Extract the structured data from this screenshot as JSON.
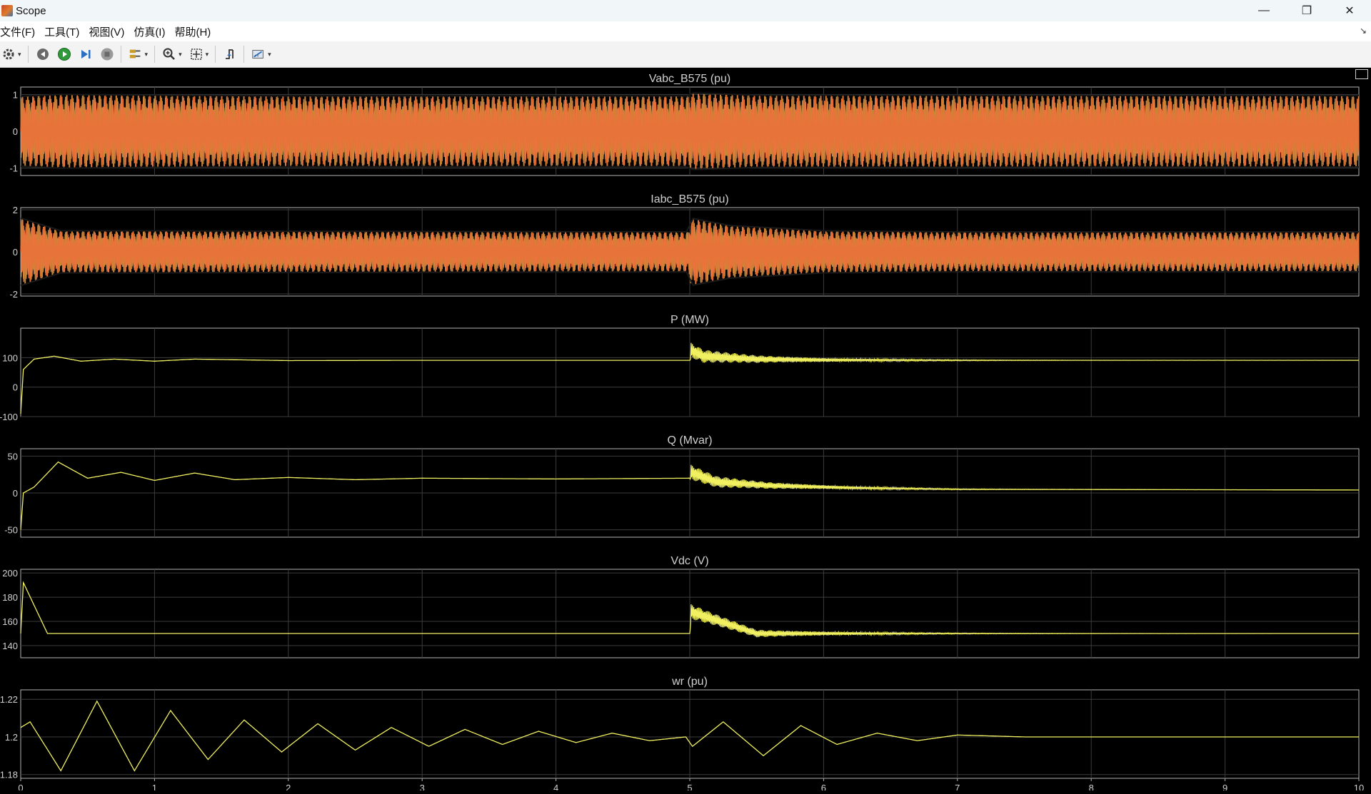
{
  "window": {
    "title": "Scope",
    "controls": {
      "minimize": "—",
      "restore": "❐",
      "close": "✕"
    }
  },
  "menu": [
    "文件(F)",
    "工具(T)",
    "视图(V)",
    "仿真(I)",
    "帮助(H)"
  ],
  "toolbar": [
    {
      "name": "settings-icon",
      "icon": "gear-icon",
      "dropdown": true
    },
    {
      "name": "step-back-icon",
      "icon": "step-back-icon",
      "dropdown": false
    },
    {
      "name": "run-icon",
      "icon": "play-icon",
      "dropdown": false
    },
    {
      "name": "step-forward-icon",
      "icon": "step-forward-icon",
      "dropdown": false
    },
    {
      "name": "stop-icon",
      "icon": "stop-icon",
      "dropdown": false
    },
    {
      "name": "highlight-icon",
      "icon": "signal-highlight-icon",
      "dropdown": true
    },
    {
      "name": "zoom-icon",
      "icon": "zoom-in-icon",
      "dropdown": true
    },
    {
      "name": "autoscale-icon",
      "icon": "fit-to-view-icon",
      "dropdown": true
    },
    {
      "name": "triggers-icon",
      "icon": "trigger-icon",
      "dropdown": false
    },
    {
      "name": "measure-icon",
      "icon": "cursor-measurement-icon",
      "dropdown": true
    }
  ],
  "colors": {
    "background": "#000000",
    "grid": "#3c3c3c",
    "axes": "#b4b4b4",
    "text": "#d0d0d0",
    "yellow": "#f0f060",
    "orange": "#e8733a",
    "blue": "#4a90d9"
  },
  "chart_data": [
    {
      "type": "line",
      "title": "Vabc_B575 (pu)",
      "kind": "ac",
      "ylim": [
        -1.2,
        1.2
      ],
      "yticks": [
        1,
        0,
        -1
      ],
      "ytick_labels": [
        "1",
        "0",
        "-1"
      ],
      "xlim": [
        0,
        10
      ],
      "series": [
        {
          "name": "",
          "color": "#e8733a",
          "x": [
            0,
            0.3,
            1,
            2,
            4.99,
            5.01,
            5.5,
            10
          ],
          "envelope": [
            0.95,
            1.0,
            0.98,
            0.96,
            0.96,
            1.04,
            0.98,
            0.97
          ]
        }
      ]
    },
    {
      "type": "line",
      "title": "Iabc_B575 (pu)",
      "kind": "ac",
      "ylim": [
        -2.1,
        2.1
      ],
      "yticks": [
        2,
        0,
        -2
      ],
      "ytick_labels": [
        "2",
        "0",
        "-2"
      ],
      "xlim": [
        0,
        10
      ],
      "series": [
        {
          "name": "",
          "color": "#e8733a",
          "x": [
            0,
            0.05,
            0.3,
            1,
            2,
            4.99,
            5.01,
            5.3,
            6,
            7,
            10
          ],
          "envelope": [
            1.6,
            1.5,
            1.0,
            1.0,
            0.98,
            0.95,
            1.6,
            1.25,
            1.0,
            0.95,
            0.95
          ]
        }
      ]
    },
    {
      "type": "line",
      "title": "P (MW)",
      "kind": "signal",
      "ylim": [
        -100,
        200
      ],
      "yticks": [
        100,
        0,
        -100
      ],
      "ytick_labels": [
        "100",
        "0",
        "-100"
      ],
      "xlim": [
        0,
        10
      ],
      "series": [
        {
          "name": "",
          "color": "#f0f060",
          "x": [
            0,
            0.02,
            0.1,
            0.25,
            0.45,
            0.7,
            1.0,
            1.3,
            2,
            3,
            5,
            5.01,
            5.1,
            5.5,
            6,
            7,
            10
          ],
          "y": [
            -90,
            60,
            95,
            105,
            88,
            95,
            88,
            95,
            90,
            91,
            91,
            125,
            105,
            95,
            92,
            91,
            91
          ]
        }
      ]
    },
    {
      "type": "line",
      "title": "Q (Mvar)",
      "kind": "signal",
      "ylim": [
        -60,
        60
      ],
      "yticks": [
        50,
        0,
        -50
      ],
      "ytick_labels": [
        "50",
        "0",
        "-50"
      ],
      "xlim": [
        0,
        10
      ],
      "series": [
        {
          "name": "",
          "color": "#f0f060",
          "x": [
            0,
            0.02,
            0.1,
            0.28,
            0.5,
            0.75,
            1.0,
            1.3,
            1.6,
            2,
            2.5,
            3,
            4,
            5,
            5.01,
            5.2,
            5.6,
            6.2,
            7,
            10
          ],
          "y": [
            -50,
            0,
            8,
            42,
            20,
            28,
            17,
            27,
            18,
            21,
            18,
            20,
            19,
            20,
            28,
            15,
            10,
            7,
            5,
            4
          ]
        }
      ]
    },
    {
      "type": "line",
      "title": "Vdc (V)",
      "kind": "signal",
      "ylim": [
        130,
        203
      ],
      "yticks": [
        200,
        180,
        160,
        140
      ],
      "ytick_labels": [
        "200",
        "180",
        "160",
        "140"
      ],
      "xlim": [
        0,
        10
      ],
      "series": [
        {
          "name": "",
          "color": "#f0f060",
          "x": [
            0,
            0.02,
            0.2,
            1,
            5,
            5.01,
            5.5,
            6,
            7,
            10
          ],
          "y": [
            150,
            192,
            150,
            150,
            150,
            168,
            150,
            150,
            150,
            150
          ]
        }
      ]
    },
    {
      "type": "line",
      "title": "wr (pu)",
      "kind": "signal",
      "ylim": [
        1.178,
        1.225
      ],
      "yticks": [
        1.22,
        1.2,
        1.18
      ],
      "ytick_labels": [
        "1.22",
        "1.2",
        "1.18"
      ],
      "xlim": [
        0,
        10
      ],
      "xticks": [
        0,
        1,
        2,
        3,
        4,
        5,
        6,
        7,
        8,
        9,
        10
      ],
      "xtick_labels": [
        "0",
        "1",
        "2",
        "3",
        "4",
        "5",
        "6",
        "7",
        "8",
        "9",
        "10"
      ],
      "series": [
        {
          "name": "",
          "color": "#f0f060",
          "x": [
            0,
            0.07,
            0.3,
            0.57,
            0.85,
            1.12,
            1.4,
            1.67,
            1.95,
            2.22,
            2.5,
            2.77,
            3.05,
            3.32,
            3.6,
            3.87,
            4.15,
            4.42,
            4.7,
            4.97,
            5.02,
            5.25,
            5.55,
            5.83,
            6.1,
            6.4,
            6.7,
            7.0,
            7.5,
            8,
            10
          ],
          "y": [
            1.205,
            1.208,
            1.182,
            1.219,
            1.182,
            1.214,
            1.188,
            1.209,
            1.192,
            1.207,
            1.193,
            1.205,
            1.195,
            1.204,
            1.196,
            1.203,
            1.197,
            1.202,
            1.198,
            1.2,
            1.195,
            1.208,
            1.19,
            1.206,
            1.196,
            1.202,
            1.198,
            1.201,
            1.2,
            1.2,
            1.2
          ]
        }
      ]
    }
  ]
}
